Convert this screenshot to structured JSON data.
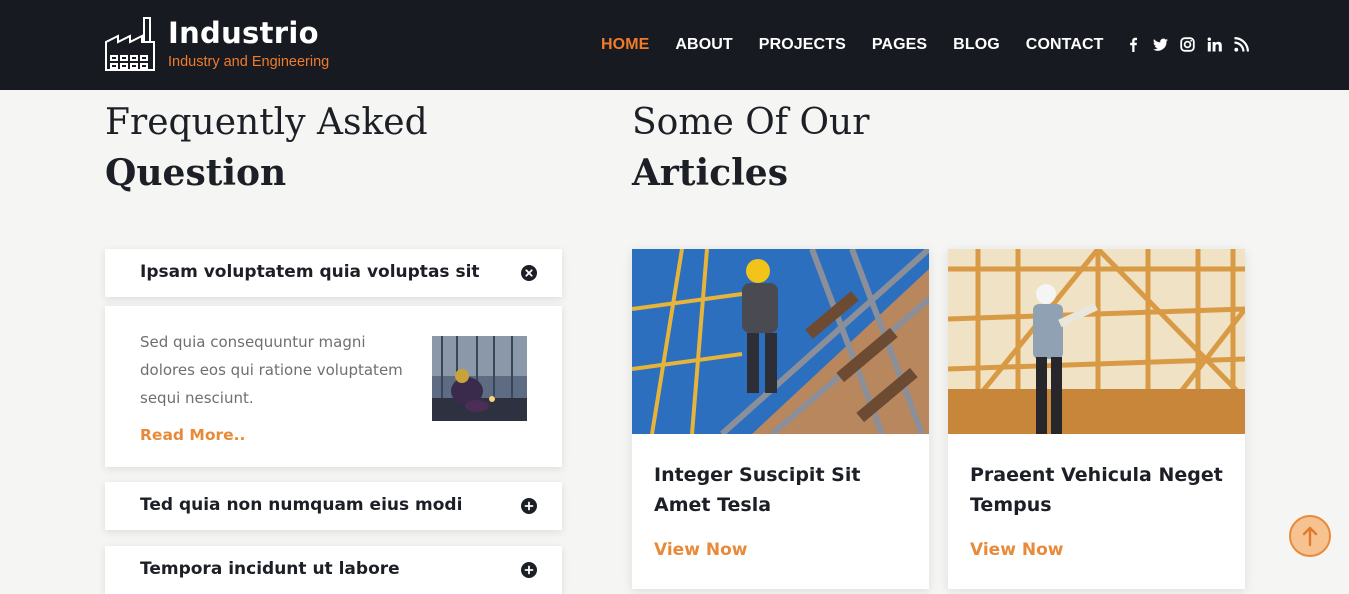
{
  "brand": {
    "name": "Industrio",
    "tagline": "Industry and Engineering",
    "accent": "#f07b2b"
  },
  "nav": {
    "items": [
      "HOME",
      "ABOUT",
      "PROJECTS",
      "PAGES",
      "BLOG",
      "CONTACT"
    ],
    "active": "HOME"
  },
  "social": [
    "facebook-icon",
    "twitter-icon",
    "instagram-icon",
    "linkedin-icon",
    "rss-icon"
  ],
  "faq": {
    "heading_line1": "Frequently Asked",
    "heading_line2": "Question",
    "items": [
      {
        "question": "Ipsam voluptatem quia voluptas sit",
        "expanded": true,
        "answer": "Sed quia consequuntur magni dolores eos qui ratione voluptatem sequi nesciunt.",
        "link": "Read More.."
      },
      {
        "question": "Ted quia non numquam eius modi",
        "expanded": false
      },
      {
        "question": "Tempora incidunt ut labore",
        "expanded": false
      }
    ]
  },
  "articles": {
    "heading_line1": "Some Of Our",
    "heading_line2": "Articles",
    "cards": [
      {
        "title": "Integer Suscipit Sit Amet Tesla",
        "link": "View Now"
      },
      {
        "title": "Praeent Vehicula Neget Tempus",
        "link": "View Now"
      }
    ]
  }
}
